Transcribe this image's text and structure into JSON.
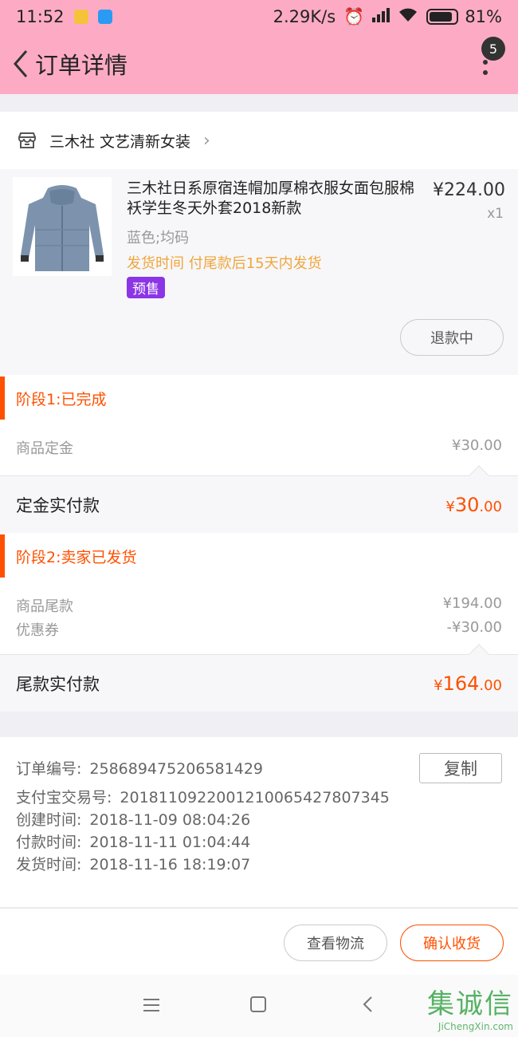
{
  "status_bar": {
    "time": "11:52",
    "speed": "2.29K/s",
    "battery": "81%"
  },
  "nav": {
    "title": "订单详情",
    "badge": "5"
  },
  "shop": {
    "name": "三木社 文艺清新女装"
  },
  "product": {
    "title": "三木社日系原宿连帽加厚棉衣服女面包服棉袄学生冬天外套2018新款",
    "price": "¥224.00",
    "qty": "x1",
    "spec": "蓝色;均码",
    "ship_time": "发货时间 付尾款后15天内发货",
    "presale": "预售",
    "refund_label": "退款中"
  },
  "stage1": {
    "title": "阶段1:已完成",
    "rows": [
      {
        "label": "商品定金",
        "value": "¥30.00"
      }
    ],
    "pay_label": "定金实付款",
    "pay_currency": "¥",
    "pay_int": "30",
    "pay_dec": ".00"
  },
  "stage2": {
    "title": "阶段2:卖家已发货",
    "rows": [
      {
        "label": "商品尾款",
        "value": "¥194.00"
      },
      {
        "label": "优惠券",
        "value": "-¥30.00"
      }
    ],
    "pay_label": "尾款实付款",
    "pay_currency": "¥",
    "pay_int": "164",
    "pay_dec": ".00"
  },
  "order_info": {
    "copy_label": "复制",
    "rows": [
      {
        "k": "订单编号:",
        "v": "258689475206581429"
      },
      {
        "k": "支付宝交易号:",
        "v": "2018110922001210065427807345"
      },
      {
        "k": "创建时间:",
        "v": "2018-11-09 08:04:26"
      },
      {
        "k": "付款时间:",
        "v": "2018-11-11 01:04:44"
      },
      {
        "k": "发货时间:",
        "v": "2018-11-16 18:19:07"
      }
    ]
  },
  "actions": {
    "logistics": "查看物流",
    "confirm": "确认收货"
  },
  "watermark": {
    "text": "集诚信",
    "url": "JiChengXin.com"
  },
  "colors": {
    "header_pink": "#fdabc5",
    "accent_orange": "#ff5000",
    "presale_purple": "#8b35e6",
    "ship_yellow": "#f0a63d"
  }
}
